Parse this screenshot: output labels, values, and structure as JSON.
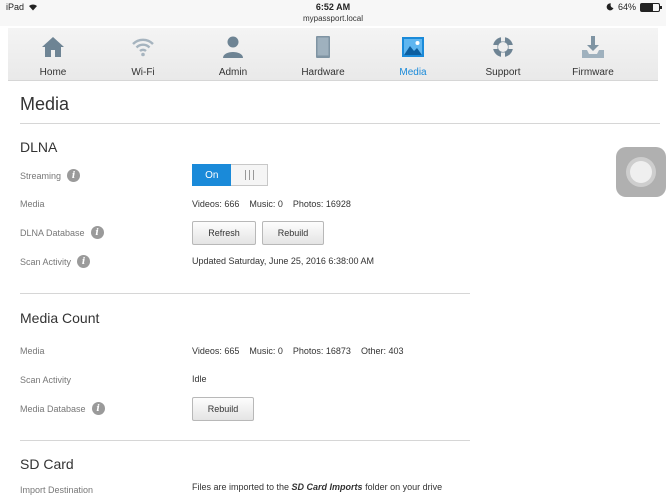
{
  "status_bar": {
    "device": "iPad",
    "time": "6:52 AM",
    "url": "mypassport.local",
    "battery": "64%",
    "battery_level": 0.64
  },
  "nav": {
    "items": [
      {
        "label": "Home",
        "icon": "home-icon"
      },
      {
        "label": "Wi-Fi",
        "icon": "wifi-icon"
      },
      {
        "label": "Admin",
        "icon": "user-icon"
      },
      {
        "label": "Hardware",
        "icon": "drive-icon"
      },
      {
        "label": "Media",
        "icon": "picture-icon",
        "active": true
      },
      {
        "label": "Support",
        "icon": "lifebuoy-icon"
      },
      {
        "label": "Firmware",
        "icon": "download-icon"
      }
    ],
    "accent": "#1a8ad9"
  },
  "page": {
    "title": "Media"
  },
  "dlna": {
    "title": "DLNA",
    "streaming_label": "Streaming",
    "streaming_on": "On",
    "media_label": "Media",
    "media_videos": "Videos: 666",
    "media_music": "Music: 0",
    "media_photos": "Photos: 16928",
    "database_label": "DLNA Database",
    "refresh_label": "Refresh",
    "rebuild_label": "Rebuild",
    "scan_label": "Scan Activity",
    "scan_value": "Updated Saturday, June 25, 2016 6:38:00 AM"
  },
  "media_count": {
    "title": "Media Count",
    "media_label": "Media",
    "media_videos": "Videos: 665",
    "media_music": "Music: 0",
    "media_photos": "Photos: 16873",
    "media_other": "Other: 403",
    "scan_label": "Scan Activity",
    "scan_value": "Idle",
    "database_label": "Media Database",
    "rebuild_label": "Rebuild"
  },
  "sd_card": {
    "title": "SD Card",
    "import_label": "Import Destination",
    "import_pre": "Files are imported to the ",
    "import_folder": "SD Card Imports",
    "import_post": " folder on your drive"
  }
}
